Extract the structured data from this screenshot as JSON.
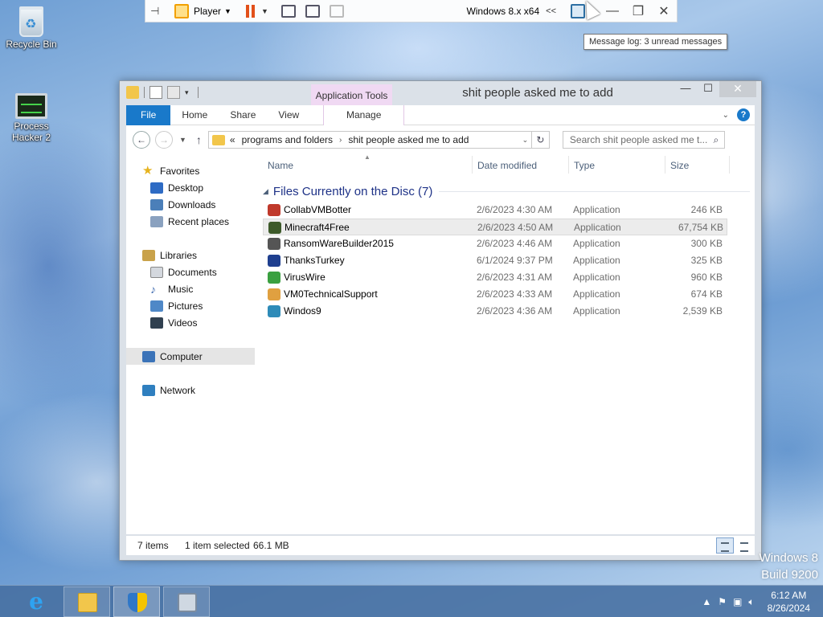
{
  "desktop": {
    "icons": [
      {
        "label": "Recycle Bin"
      },
      {
        "label": "Process Hacker 2"
      }
    ]
  },
  "vmware": {
    "player_label": "Player",
    "os_name": "Windows 8.x x64",
    "collapse_glyph": "<<",
    "tooltip": "Message log: 3 unread messages"
  },
  "window": {
    "title": "shit people asked me to add",
    "contextual_group": "Application Tools",
    "ribbon_tabs": [
      "File",
      "Home",
      "Share",
      "View",
      "Manage"
    ],
    "address": {
      "overflow": "«",
      "crumbs": [
        "programs and folders",
        "shit people asked me to add"
      ]
    },
    "search_placeholder": "Search shit people asked me t...",
    "nav_pane": {
      "favorites": "Favorites",
      "favorites_items": [
        "Desktop",
        "Downloads",
        "Recent places"
      ],
      "libraries": "Libraries",
      "libraries_items": [
        "Documents",
        "Music",
        "Pictures",
        "Videos"
      ],
      "computer": "Computer",
      "network": "Network"
    },
    "columns": [
      "Name",
      "Date modified",
      "Type",
      "Size"
    ],
    "group_title": "Files Currently on the Disc (7)",
    "files": [
      {
        "name": "CollabVMBotter",
        "date": "2/6/2023 4:30 AM",
        "type": "Application",
        "size": "246 KB",
        "icon_color": "#c0392b"
      },
      {
        "name": "Minecraft4Free",
        "date": "2/6/2023 4:50 AM",
        "type": "Application",
        "size": "67,754 KB",
        "icon_color": "#3d5a2a",
        "selected": true
      },
      {
        "name": "RansomWareBuilder2015",
        "date": "2/6/2023 4:46 AM",
        "type": "Application",
        "size": "300 KB",
        "icon_color": "#555555"
      },
      {
        "name": "ThanksTurkey",
        "date": "6/1/2024 9:37 PM",
        "type": "Application",
        "size": "325 KB",
        "icon_color": "#1f3f8f"
      },
      {
        "name": "VirusWire",
        "date": "2/6/2023 4:31 AM",
        "type": "Application",
        "size": "960 KB",
        "icon_color": "#3aa040"
      },
      {
        "name": "VM0TechnicalSupport",
        "date": "2/6/2023 4:33 AM",
        "type": "Application",
        "size": "674 KB",
        "icon_color": "#e0a040"
      },
      {
        "name": "Windos9",
        "date": "2/6/2023 4:36 AM",
        "type": "Application",
        "size": "2,539 KB",
        "icon_color": "#2e8bb8"
      }
    ],
    "status": {
      "items": "7 items",
      "selection": "1 item selected",
      "selection_size": "66.1 MB"
    }
  },
  "watermark": {
    "line1": "Windows 8",
    "line2": "Build 9200"
  },
  "taskbar": {
    "apps": [
      "ie-icon",
      "file-explorer-icon",
      "shield-icon",
      "setup-icon"
    ],
    "time": "6:12 AM",
    "date": "8/26/2024"
  }
}
